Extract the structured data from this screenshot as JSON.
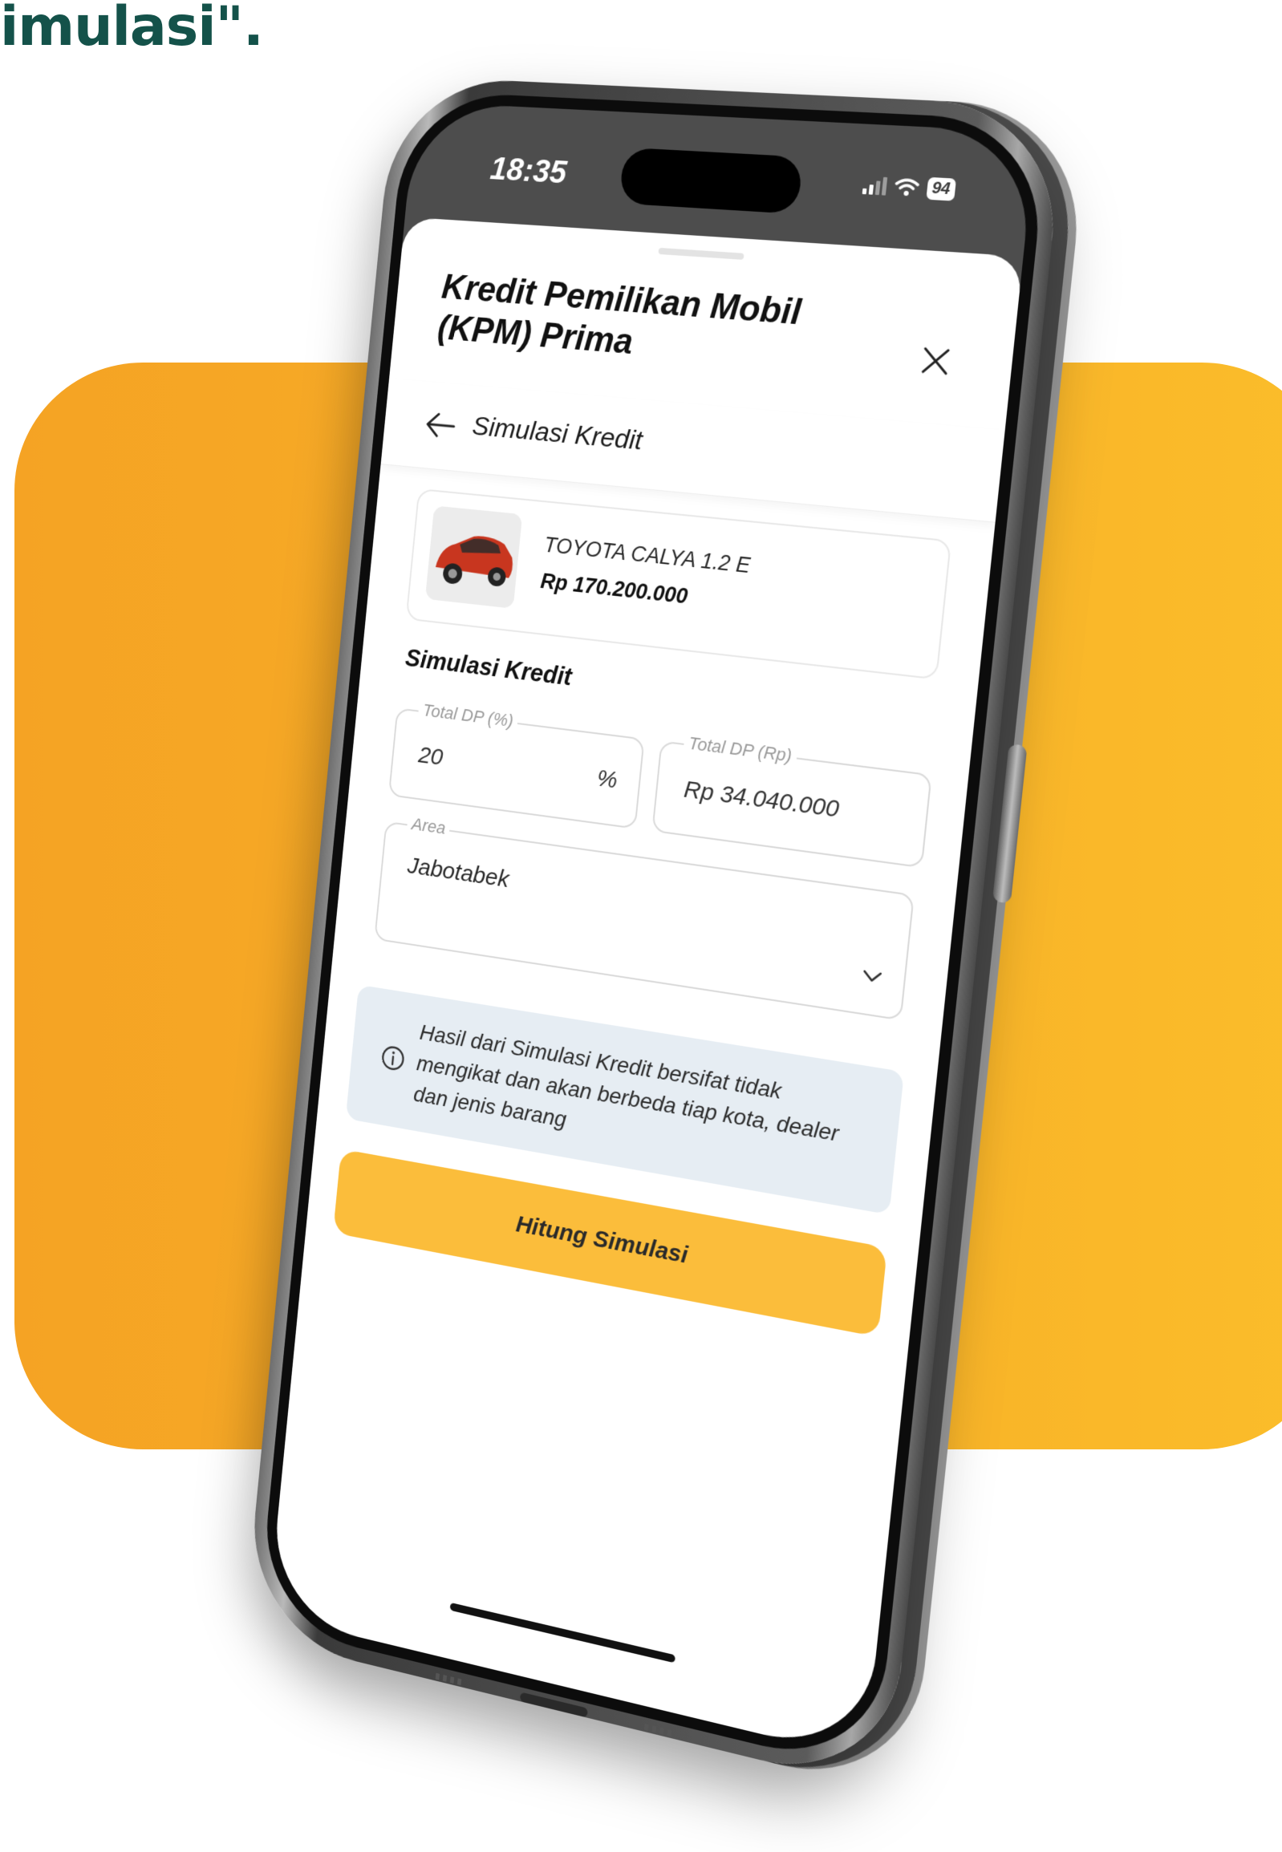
{
  "headline": "imulasi\".",
  "status_bar": {
    "time": "18:35",
    "battery": "94"
  },
  "sheet": {
    "title": "Kredit Pemilikan Mobil (KPM) Prima"
  },
  "nav": {
    "title": "Simulasi Kredit"
  },
  "product": {
    "name": "TOYOTA CALYA 1.2 E",
    "price": "Rp 170.200.000"
  },
  "form": {
    "section_title": "Simulasi Kredit",
    "dp_percent": {
      "label": "Total DP (%)",
      "value": "20",
      "suffix": "%"
    },
    "dp_amount": {
      "label": "Total DP (Rp)",
      "value": "Rp  34.040.000"
    },
    "area": {
      "label": "Area",
      "value": "Jabotabek"
    }
  },
  "info": {
    "text": "Hasil dari Simulasi Kredit bersifat tidak mengikat dan akan berbeda tiap kota, dealer dan jenis barang"
  },
  "actions": {
    "calculate_label": "Hitung Simulasi"
  },
  "colors": {
    "headline": "#14524a",
    "panel_orange": "#f5a324",
    "panel_yellow": "#fbbd2a",
    "button": "#fbbd3b",
    "info_bg": "#e6edf3"
  }
}
